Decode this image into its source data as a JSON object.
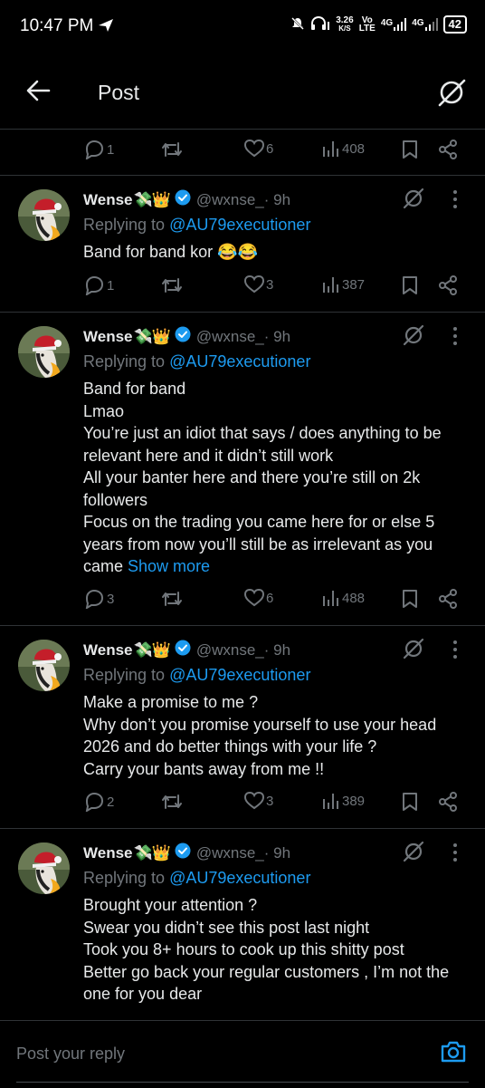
{
  "status_bar": {
    "time": "10:47 PM",
    "net_speed_value": "3.26",
    "net_speed_unit": "K/S",
    "volte_top": "Vo",
    "volte_bottom": "LTE",
    "sig1": "4G",
    "sig2": "4G",
    "battery": "42"
  },
  "header": {
    "title": "Post"
  },
  "top_actions": {
    "replies": "1",
    "likes": "6",
    "views": "408"
  },
  "replies": [
    {
      "name": "Wense",
      "emoji": "💸👑",
      "handle": "@wxnse_",
      "time": "· 9h",
      "replying_prefix": "Replying to",
      "replying_to": "@AU79executioner",
      "lines": [
        "Band for band kor 😂😂"
      ],
      "show_more": "",
      "actions": {
        "replies": "1",
        "reposts": "",
        "likes": "3",
        "views": "387"
      }
    },
    {
      "name": "Wense",
      "emoji": "💸👑",
      "handle": "@wxnse_",
      "time": "· 9h",
      "replying_prefix": "Replying to",
      "replying_to": "@AU79executioner",
      "lines": [
        "Band for band",
        "Lmao",
        "You’re just an idiot that says / does anything to be relevant here and it didn’t still work",
        "All your banter here and there you’re still on 2k followers",
        "Focus on the trading you came here for or else 5 years from now you’ll still be as irrelevant as you came"
      ],
      "show_more": "Show more",
      "actions": {
        "replies": "3",
        "reposts": "",
        "likes": "6",
        "views": "488"
      }
    },
    {
      "name": "Wense",
      "emoji": "💸👑",
      "handle": "@wxnse_",
      "time": "· 9h",
      "replying_prefix": "Replying to",
      "replying_to": "@AU79executioner",
      "lines": [
        "Make a promise to me ?",
        "Why don’t you promise yourself to use your head 2026 and do better things with your life ?",
        "Carry your bants away from me !!"
      ],
      "show_more": "",
      "actions": {
        "replies": "2",
        "reposts": "",
        "likes": "3",
        "views": "389"
      }
    },
    {
      "name": "Wense",
      "emoji": "💸👑",
      "handle": "@wxnse_",
      "time": "· 9h",
      "replying_prefix": "Replying to",
      "replying_to": "@AU79executioner",
      "lines": [
        "Brought your attention ?",
        "Swear you didn’t see this post last night",
        "Took you 8+ hours to cook up this shitty post",
        "Better go back your regular customers , I’m not the one for you dear"
      ],
      "show_more": "",
      "actions": null
    }
  ],
  "composer": {
    "placeholder": "Post your reply"
  },
  "colors": {
    "background": "#000000",
    "text": "#e7e9ea",
    "muted": "#71767b",
    "accent": "#1d9bf0",
    "divider": "#2f3336"
  },
  "icons": [
    "send-icon",
    "mute-icon",
    "headphones-icon",
    "signal-icon",
    "battery-icon",
    "back-arrow-icon",
    "grok-icon",
    "reply-icon",
    "repost-icon",
    "like-icon",
    "views-icon",
    "bookmark-icon",
    "share-icon",
    "verified-icon",
    "more-icon",
    "camera-icon"
  ]
}
